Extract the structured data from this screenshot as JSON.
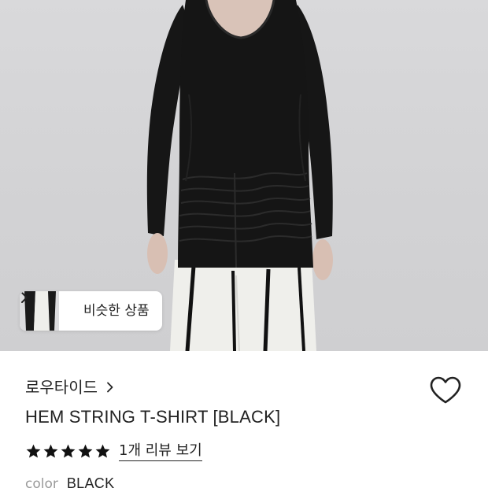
{
  "hero": {
    "image_desc": "product-photo"
  },
  "similar_products": {
    "label": "비슷한 상품",
    "chevron_icon": "chevron-right-icon"
  },
  "product": {
    "brand": "로우타이드",
    "brand_chevron_icon": "chevron-right-icon",
    "name": "HEM STRING T-SHIRT [BLACK]",
    "wishlist_icon": "heart-outline-icon",
    "rating": {
      "stars": 5,
      "max": 5,
      "star_icon": "star-icon",
      "review_link": "1개 리뷰 보기"
    },
    "color": {
      "label": "color",
      "value": "BLACK"
    }
  },
  "colors": {
    "text": "#222222",
    "muted": "#9a9a9a",
    "photo_bg": "#d4d4d6",
    "garment": "#141414",
    "pants": "#efefeb"
  }
}
